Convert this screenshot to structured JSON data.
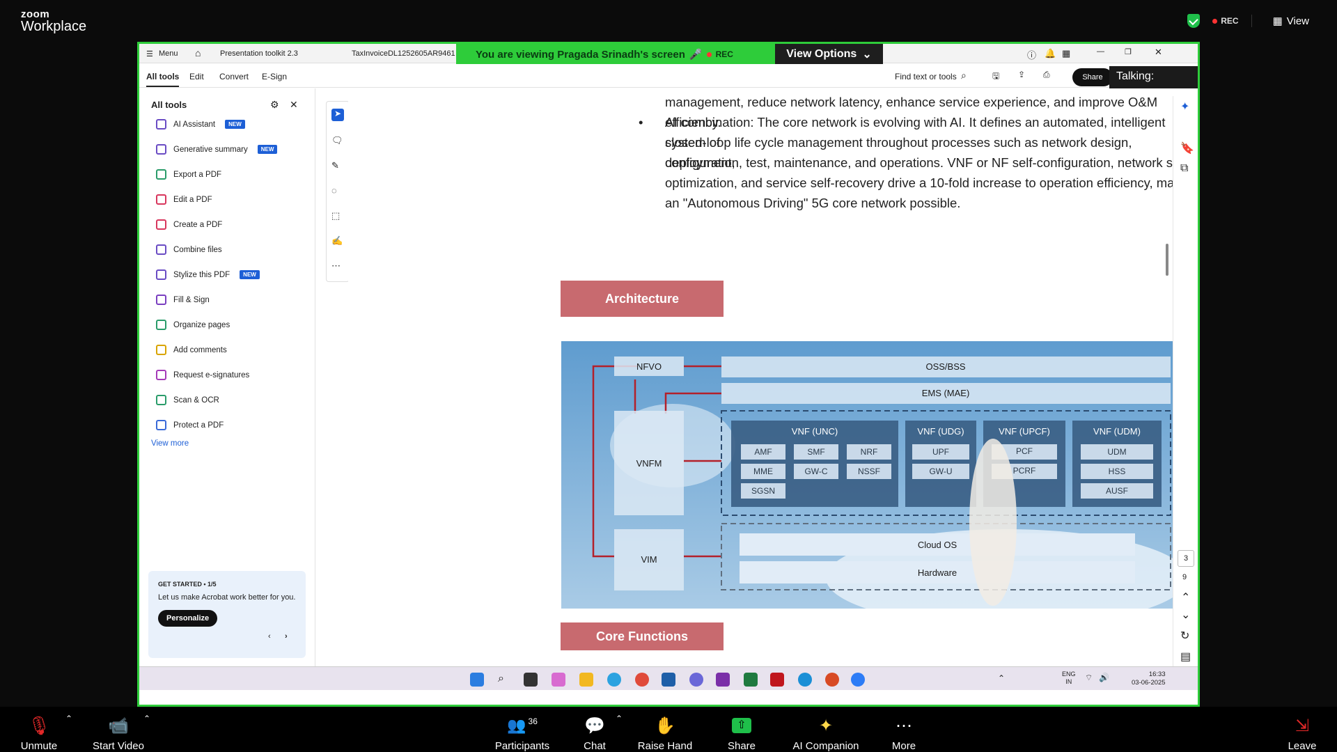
{
  "zoom": {
    "brand_top": "zoom",
    "brand_bottom": "Workplace",
    "rec": "REC",
    "view": "View",
    "talking": "Talking:"
  },
  "share_banner": {
    "viewing": "You are viewing  Pragada Srinadh's screen",
    "rec": "REC",
    "view_options": "View Options"
  },
  "tabs": {
    "menu": "Menu",
    "tab1": "Presentation  toolkit 2.3",
    "tab2": "TaxInvoiceDL1252605AR9461"
  },
  "acrobat_toolbar": {
    "all_tools": "All tools",
    "edit": "Edit",
    "convert": "Convert",
    "esign": "E-Sign",
    "find": "Find text or tools",
    "share": "Share",
    "ai_assistant": "AI Assistant"
  },
  "left_panel": {
    "title": "All tools",
    "items": [
      {
        "label": "AI Assistant",
        "badge": "NEW"
      },
      {
        "label": "Generative summary",
        "badge": "NEW"
      },
      {
        "label": "Export a PDF",
        "badge": ""
      },
      {
        "label": "Edit a PDF",
        "badge": ""
      },
      {
        "label": "Create a PDF",
        "badge": ""
      },
      {
        "label": "Combine files",
        "badge": ""
      },
      {
        "label": "Stylize this PDF",
        "badge": "NEW"
      },
      {
        "label": "Fill & Sign",
        "badge": ""
      },
      {
        "label": "Organize pages",
        "badge": ""
      },
      {
        "label": "Add comments",
        "badge": ""
      },
      {
        "label": "Request e-signatures",
        "badge": ""
      },
      {
        "label": "Scan & OCR",
        "badge": ""
      },
      {
        "label": "Protect a PDF",
        "badge": ""
      }
    ],
    "view_more": "View more",
    "get_started": "GET STARTED • 1/5",
    "get_started_text": "Let us make Acrobat work better for you.",
    "personalize": "Personalize"
  },
  "document": {
    "line0": "management, reduce network latency, enhance service experience, and improve O&M efficiency.",
    "line1": "AI combination: The core network is evolving with AI. It defines an automated, intelligent system of",
    "line2": "closed-loop life cycle management throughout processes such as network design, deployment,",
    "line3": "configuration, test, maintenance, and operations. VNF or NF self-configuration, network self-",
    "line4": "optimization, and service self-recovery drive a 10-fold increase to operation efficiency, making",
    "line5": "an \"Autonomous Driving\" 5G core network possible.",
    "section1": "Architecture",
    "section2": "Core Functions"
  },
  "diagram": {
    "nfvo": "NFVO",
    "vnfm": "VNFM",
    "vim": "VIM",
    "oss": "OSS/BSS",
    "ems": "EMS (MAE)",
    "unc": "VNF (UNC)",
    "udg": "VNF (UDG)",
    "upcf": "VNF (UPCF)",
    "udm": "VNF (UDM)",
    "amf": "AMF",
    "smf": "SMF",
    "nrf": "NRF",
    "mme": "MME",
    "gwc": "GW-C",
    "nssf": "NSSF",
    "sgsn": "SGSN",
    "upf": "UPF",
    "gwu": "GW-U",
    "pcf": "PCF",
    "pcrf": "PCRF",
    "udm2": "UDM",
    "hss": "HSS",
    "ausf": "AUSF",
    "cloudos": "Cloud OS",
    "hardware": "Hardware"
  },
  "page_nav": {
    "current": "3",
    "total": "9"
  },
  "taskbar": {
    "lang1": "ENG",
    "lang2": "IN",
    "time": "16:33",
    "date": "03-06-2025"
  },
  "bottom_bar": {
    "unmute": "Unmute",
    "start_video": "Start Video",
    "participants": "Participants",
    "participants_count": "36",
    "chat": "Chat",
    "raise_hand": "Raise Hand",
    "share_screen": "Share Screen",
    "ai_companion": "AI Companion",
    "more": "More",
    "leave": "Leave"
  }
}
